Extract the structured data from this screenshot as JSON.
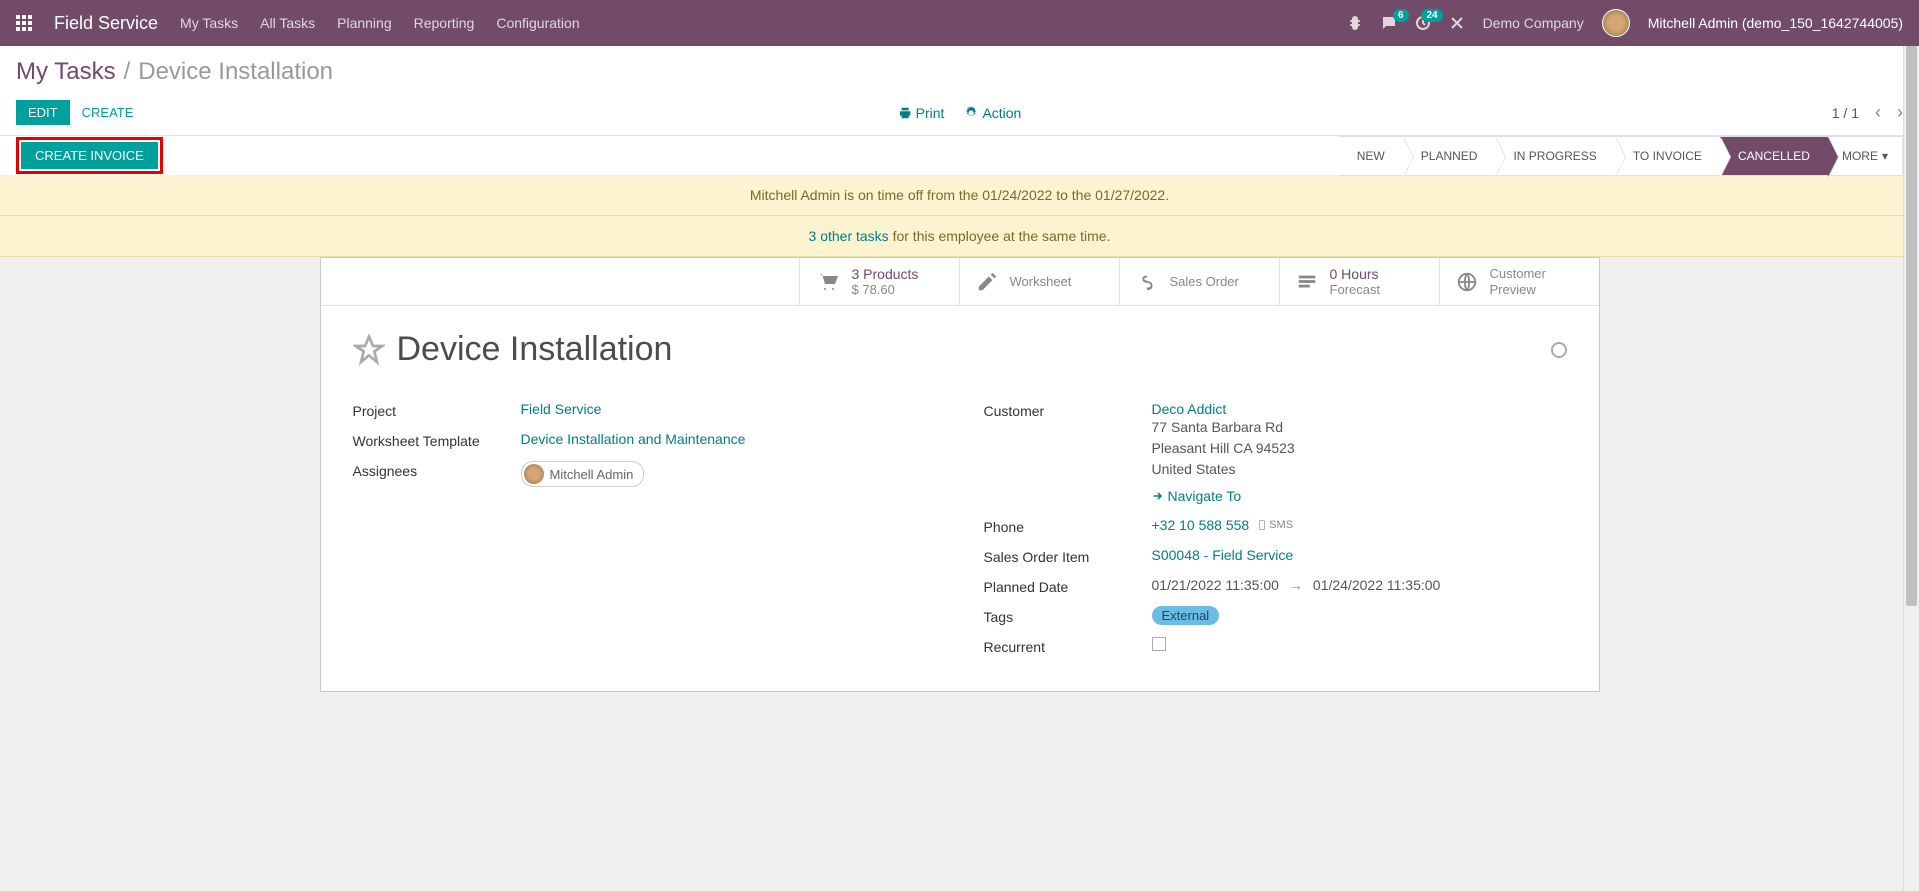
{
  "navbar": {
    "app_title": "Field Service",
    "menu": [
      "My Tasks",
      "All Tasks",
      "Planning",
      "Reporting",
      "Configuration"
    ],
    "messages_badge": "6",
    "activities_badge": "24",
    "company": "Demo Company",
    "user": "Mitchell Admin (demo_150_1642744005)"
  },
  "breadcrumb": {
    "parent": "My Tasks",
    "current": "Device Installation"
  },
  "toolbar": {
    "edit_label": "EDIT",
    "create_label": "CREATE",
    "print_label": "Print",
    "action_label": "Action",
    "pager": "1 / 1"
  },
  "statusbar": {
    "create_invoice": "CREATE INVOICE",
    "stages": [
      "NEW",
      "PLANNED",
      "IN PROGRESS",
      "TO INVOICE",
      "CANCELLED"
    ],
    "active_stage": "CANCELLED",
    "more_label": "MORE"
  },
  "warnings": {
    "timeoff": "Mitchell Admin is on time off from the 01/24/2022 to the 01/27/2022.",
    "other_tasks_link": "3 other tasks",
    "other_tasks_suffix": " for this employee at the same time."
  },
  "stat_buttons": {
    "products_count": "3 Products",
    "products_amount": "$ 78.60",
    "worksheet": "Worksheet",
    "sales_order": "Sales Order",
    "hours_count": "0  Hours",
    "forecast": "Forecast",
    "customer_preview": "Customer Preview"
  },
  "record": {
    "title": "Device Installation",
    "project_label": "Project",
    "project_value": "Field Service",
    "worksheet_template_label": "Worksheet Template",
    "worksheet_template_value": "Device Installation and Maintenance",
    "assignees_label": "Assignees",
    "assignee_name": "Mitchell Admin",
    "customer_label": "Customer",
    "customer_name": "Deco Addict",
    "address_line1": "77 Santa Barbara Rd",
    "address_line2": "Pleasant Hill CA 94523",
    "address_country": "United States",
    "navigate_label": "Navigate To",
    "phone_label": "Phone",
    "phone_value": "+32 10 588 558",
    "sms_label": "SMS",
    "sales_order_item_label": "Sales Order Item",
    "sales_order_item_value": "S00048 - Field Service",
    "planned_date_label": "Planned Date",
    "planned_date_start": "01/21/2022 11:35:00",
    "planned_date_end": "01/24/2022 11:35:00",
    "tags_label": "Tags",
    "tag_value": "External",
    "recurrent_label": "Recurrent"
  }
}
